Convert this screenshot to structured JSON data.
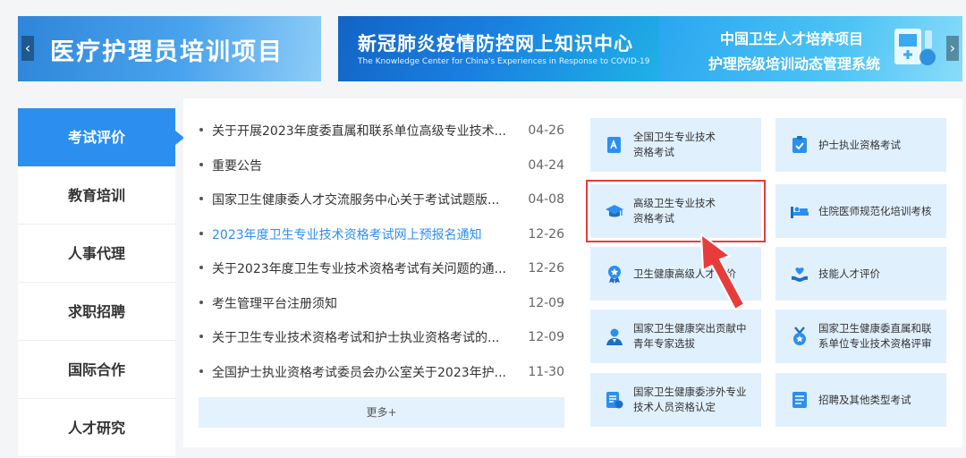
{
  "banner": {
    "slide1_title": "医疗护理员培训项目",
    "slide2_title": "新冠肺炎疫情防控网上知识中心",
    "slide2_sub": "The Knowledge Center for China's Experiences in Response to COVID-19",
    "slide3_line1": "中国卫生人才培养项目",
    "slide3_line2": "护理院级培训动态管理系统",
    "prev": "‹",
    "next": "›"
  },
  "sidebar": {
    "items": [
      {
        "label": "考试评价",
        "active": true
      },
      {
        "label": "教育培训"
      },
      {
        "label": "人事代理"
      },
      {
        "label": "求职招聘"
      },
      {
        "label": "国际合作"
      },
      {
        "label": "人才研究"
      }
    ]
  },
  "news": {
    "items": [
      {
        "title": "关于开展2023年度委直属和联系单位高级专业技术...",
        "date": "04-26"
      },
      {
        "title": "重要公告",
        "date": "04-24"
      },
      {
        "title": "国家卫生健康委人才交流服务中心关于考试试题版...",
        "date": "04-08"
      },
      {
        "title": "2023年度卫生专业技术资格考试网上预报名通知",
        "date": "12-26",
        "highlight": true
      },
      {
        "title": "关于2023年度卫生专业技术资格考试有关问题的通...",
        "date": "12-26"
      },
      {
        "title": "考生管理平台注册须知",
        "date": "12-09"
      },
      {
        "title": "关于卫生专业技术资格考试和护士执业资格考试的...",
        "date": "12-09"
      },
      {
        "title": "全国护士执业资格考试委员会办公室关于2023年护...",
        "date": "11-30"
      }
    ],
    "more_label": "更多+"
  },
  "cards": [
    {
      "label": "全国卫生专业技术\n资格考试",
      "icon": "certificate-icon"
    },
    {
      "label": "护士执业资格考试",
      "icon": "clipboard-check-icon"
    },
    {
      "label": "高级卫生专业技术\n资格考试",
      "icon": "graduation-cap-icon"
    },
    {
      "label": "住院医师规范化培训考核",
      "icon": "hospital-bed-icon"
    },
    {
      "label": "卫生健康高级人才评价",
      "icon": "medal-icon"
    },
    {
      "label": "技能人才评价",
      "icon": "hand-heart-icon"
    },
    {
      "label": "国家卫生健康突出贡献中\n青年专家选拔",
      "icon": "expert-person-icon"
    },
    {
      "label": "国家卫生健康委直属和联\n系单位专业技术资格评审",
      "icon": "award-badge-icon"
    },
    {
      "label": "国家卫生健康委涉外专业\n技术人员资格认定",
      "icon": "document-seal-icon"
    },
    {
      "label": "招聘及其他类型考试",
      "icon": "form-list-icon"
    }
  ],
  "colors": {
    "accent": "#2c8ff0",
    "card_bg": "#e1f0fd",
    "highlight_border": "#e73c3c"
  }
}
